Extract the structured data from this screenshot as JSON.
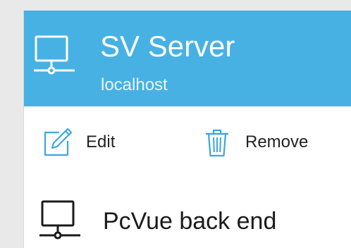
{
  "server": {
    "title": "SV Server",
    "host": "localhost",
    "icon": "server-network-icon"
  },
  "actions": {
    "edit_label": "Edit",
    "edit_icon": "edit-pencil-icon",
    "remove_label": "Remove",
    "remove_icon": "trash-icon"
  },
  "backend": {
    "label": "PcVue back end",
    "icon": "monitor-network-icon"
  },
  "colors": {
    "header_bg": "#47b1e4",
    "accent": "#3ea6de"
  }
}
